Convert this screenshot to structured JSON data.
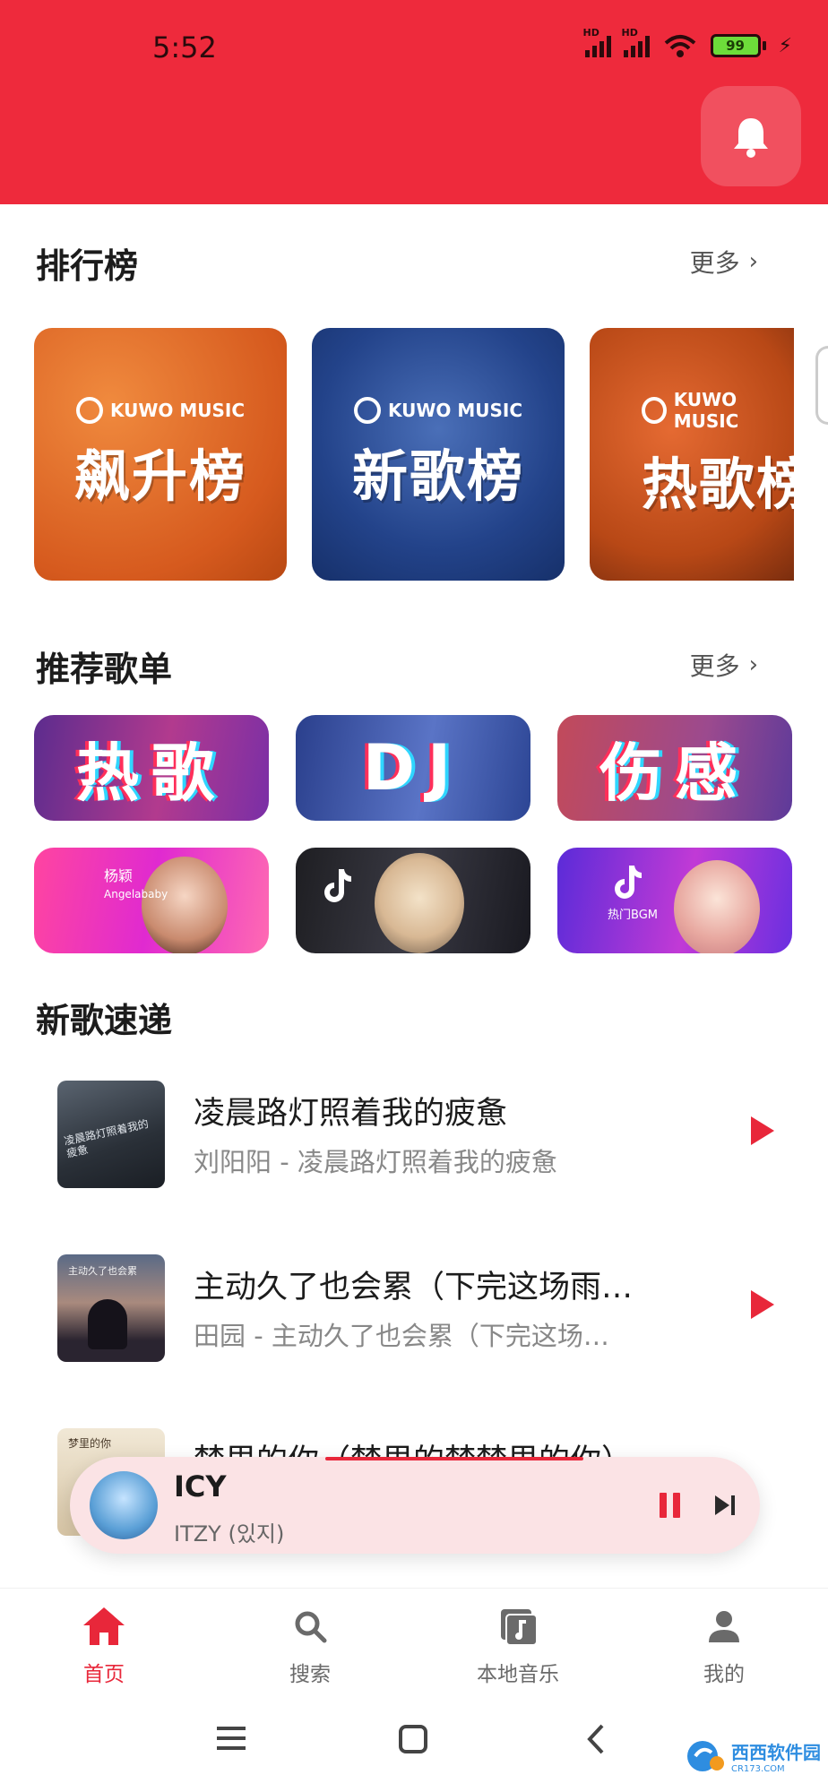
{
  "status_bar": {
    "time": "5:52",
    "sim1": "HD",
    "sim2": "HD",
    "battery": "99"
  },
  "colors": {
    "accent": "#e8273a",
    "header": "#ee2a3c"
  },
  "header": {
    "bell_icon": "bell-icon"
  },
  "charts": {
    "title": "排行榜",
    "more": "更多",
    "items": [
      {
        "brand": "KUWO MUSIC",
        "name": "飙升榜"
      },
      {
        "brand": "KUWO MUSIC",
        "name": "新歌榜"
      },
      {
        "brand": "KUWO MUSIC",
        "name": "热歌榜"
      }
    ]
  },
  "playlists": {
    "title": "推荐歌单",
    "more": "更多",
    "text_cards": [
      "热歌",
      "DJ",
      "伤感"
    ],
    "image_cards": [
      {
        "caption": "杨颖",
        "caption2": "Angelababy"
      },
      {
        "caption": ""
      },
      {
        "caption": "热门BGM"
      }
    ]
  },
  "new_songs": {
    "title": "新歌速递",
    "items": [
      {
        "title": "凌晨路灯照着我的疲惫",
        "subtitle": "刘阳阳 - 凌晨路灯照着我的疲惫",
        "cover_text": "凌晨路灯照着我的疲惫"
      },
      {
        "title": "主动久了也会累（下完这场雨…",
        "subtitle": "田园 - 主动久了也会累（下完这场…",
        "cover_text": "主动久了也会累"
      },
      {
        "title": "梦里的你（梦里的梦梦里的你）",
        "subtitle": "",
        "cover_text": "梦里的你"
      }
    ]
  },
  "player": {
    "song": "ICY",
    "artist": "ITZY (있지)",
    "progress": 0.5
  },
  "nav": {
    "items": [
      {
        "label": "首页",
        "icon": "home-icon",
        "active": true
      },
      {
        "label": "搜索",
        "icon": "search-icon",
        "active": false
      },
      {
        "label": "本地音乐",
        "icon": "local-music-icon",
        "active": false
      },
      {
        "label": "我的",
        "icon": "user-icon",
        "active": false
      }
    ]
  },
  "watermark": {
    "text": "西西软件园",
    "domain": "CR173.COM"
  }
}
